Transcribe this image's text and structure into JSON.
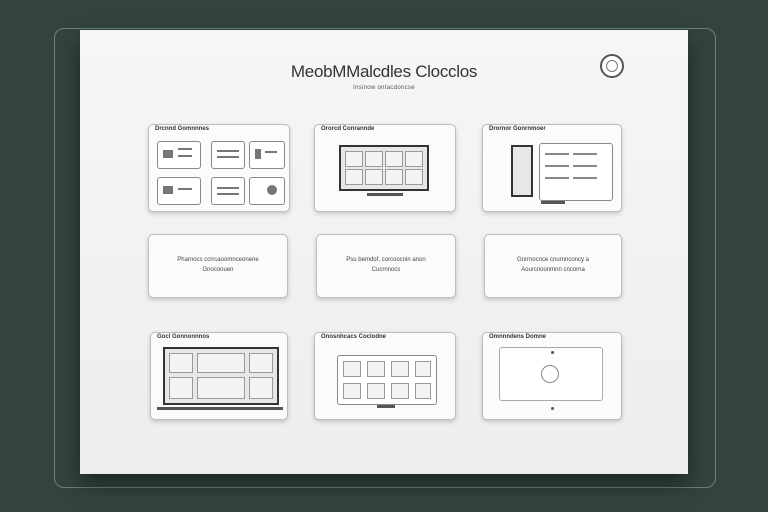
{
  "header": {
    "title": "MeobMMalcdles Clocclos",
    "subtitle": "Insinow ontacdoncse"
  },
  "cards": {
    "row1": [
      {
        "label": "Drcnnd Gomnnnes"
      },
      {
        "label": "Ororcd Conrannde"
      },
      {
        "label": "Drornor Gonrnmoer"
      }
    ],
    "row2": [
      {
        "line1": "Pharnocs ccrrcaoomnceonene",
        "line2": "Gnocoouen"
      },
      {
        "line1": "Psu bemdof, corcoocnin anon",
        "line2": "Cucrnnocs"
      },
      {
        "line1": "Gnrrnocnce cnurnnconcy a",
        "line2": "Aourcnoonmnn cncorna"
      }
    ],
    "row3": [
      {
        "label": "Gocl Gonnonnnos"
      },
      {
        "label": "Onosnhcacs Coclodne"
      },
      {
        "label": "Omnnndens Domne"
      }
    ]
  }
}
